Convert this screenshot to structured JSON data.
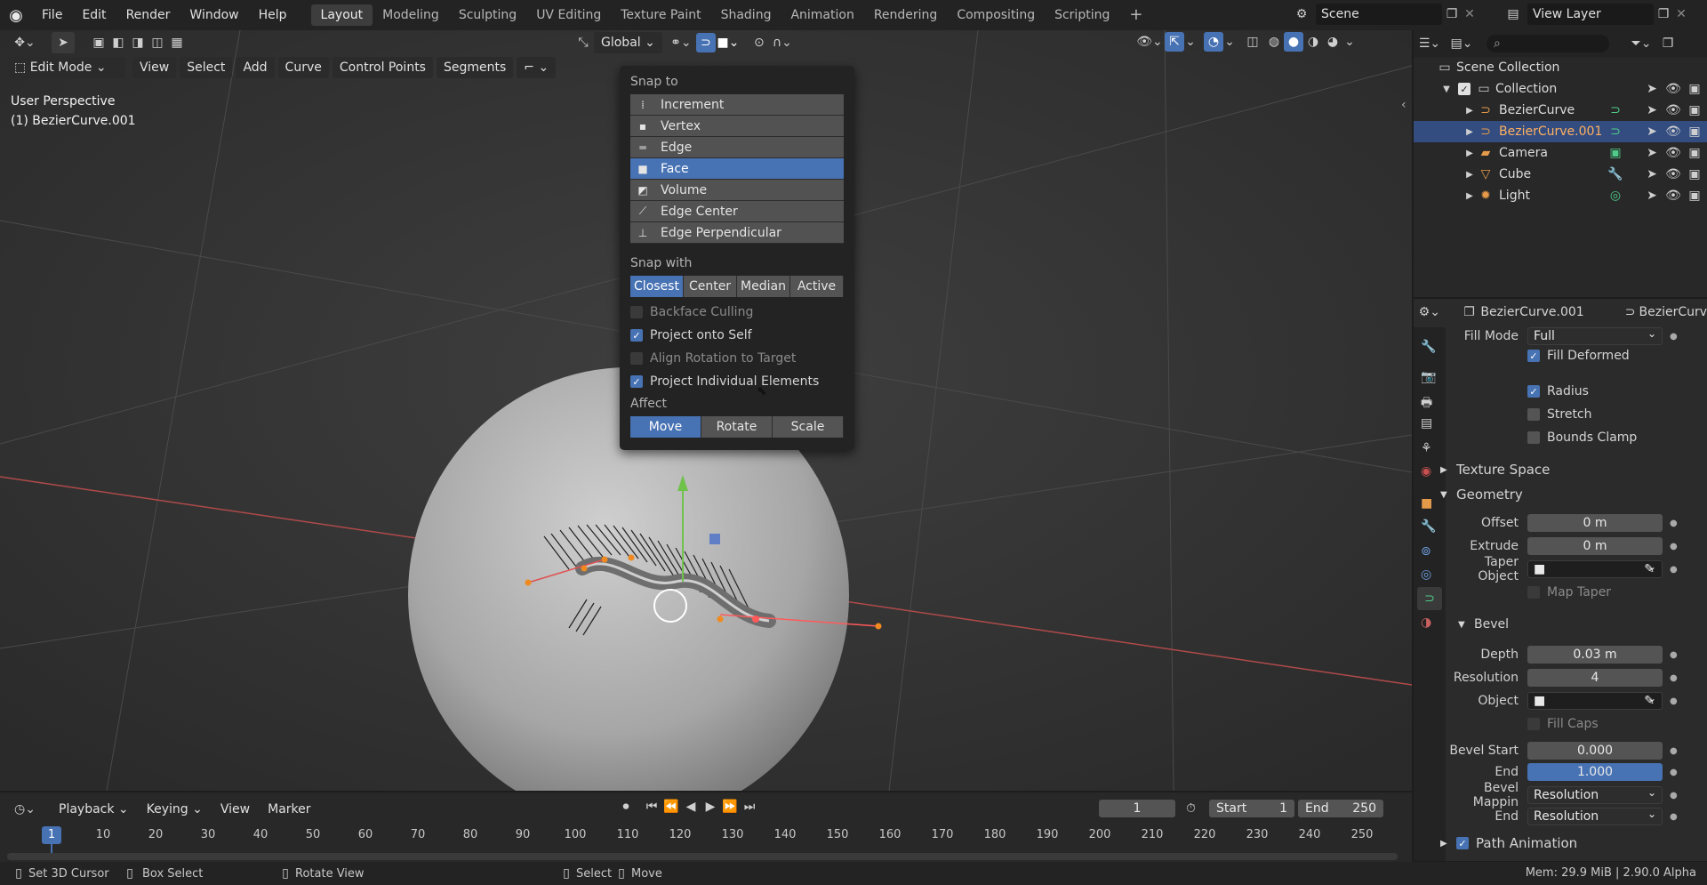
{
  "app": {
    "logo_icon": "blender-logo-icon"
  },
  "menu": [
    "File",
    "Edit",
    "Render",
    "Window",
    "Help"
  ],
  "workspaces": [
    "Layout",
    "Modeling",
    "Sculpting",
    "UV Editing",
    "Texture Paint",
    "Shading",
    "Animation",
    "Rendering",
    "Compositing",
    "Scripting"
  ],
  "active_workspace": "Layout",
  "add_workspace": "+",
  "scene": {
    "label": "Scene",
    "view_layer": "View Layer"
  },
  "viewport": {
    "orientation": "Global",
    "mode": "Edit Mode",
    "header_menus": [
      "View",
      "Select",
      "Add",
      "Curve",
      "Control Points",
      "Segments"
    ],
    "perspective_label": "User Perspective",
    "object_label": "(1) BezierCurve.001"
  },
  "snap_popover": {
    "snap_to_title": "Snap to",
    "snap_to_items": [
      {
        "label": "Increment",
        "icon": "increment-icon",
        "selected": false
      },
      {
        "label": "Vertex",
        "icon": "vertex-icon",
        "selected": false
      },
      {
        "label": "Edge",
        "icon": "edge-icon",
        "selected": false
      },
      {
        "label": "Face",
        "icon": "face-icon",
        "selected": true
      },
      {
        "label": "Volume",
        "icon": "volume-icon",
        "selected": false
      },
      {
        "label": "Edge Center",
        "icon": "edge-center-icon",
        "selected": false
      },
      {
        "label": "Edge Perpendicular",
        "icon": "edge-perpendicular-icon",
        "selected": false
      }
    ],
    "snap_with_title": "Snap with",
    "snap_with": [
      {
        "label": "Closest",
        "on": true
      },
      {
        "label": "Center",
        "on": false
      },
      {
        "label": "Median",
        "on": false
      },
      {
        "label": "Active",
        "on": false
      }
    ],
    "options": [
      {
        "label": "Backface Culling",
        "checked": false,
        "enabled": false
      },
      {
        "label": "Project onto Self",
        "checked": true,
        "enabled": true
      },
      {
        "label": "Align Rotation to Target",
        "checked": false,
        "enabled": false
      },
      {
        "label": "Project Individual Elements",
        "checked": true,
        "enabled": true
      }
    ],
    "affect_title": "Affect",
    "affect": [
      {
        "label": "Move",
        "on": true
      },
      {
        "label": "Rotate",
        "on": false
      },
      {
        "label": "Scale",
        "on": false
      }
    ]
  },
  "outliner": {
    "root": "Scene Collection",
    "collection": "Collection",
    "items": [
      {
        "label": "BezierCurve",
        "icon": "curve-icon",
        "color": "#e59a4a",
        "selected": false
      },
      {
        "label": "BezierCurve.001",
        "icon": "curve-icon",
        "color": "#e59a4a",
        "selected": true
      },
      {
        "label": "Camera",
        "icon": "camera-icon",
        "color": "#e59a4a",
        "selected": false
      },
      {
        "label": "Cube",
        "icon": "mesh-icon",
        "color": "#e59a4a",
        "selected": false
      },
      {
        "label": "Light",
        "icon": "light-icon",
        "color": "#e59a4a",
        "selected": false
      }
    ]
  },
  "properties": {
    "object_name": "BezierCurve.001",
    "data_name": "BezierCurv",
    "fill_mode_label": "Fill Mode",
    "fill_mode": "Full",
    "fill_deformed": "Fill Deformed",
    "radius": "Radius",
    "stretch": "Stretch",
    "bounds_clamp": "Bounds Clamp",
    "texture_space": "Texture Space",
    "geometry": "Geometry",
    "offset_label": "Offset",
    "offset": "0 m",
    "extrude_label": "Extrude",
    "extrude": "0 m",
    "taper_label": "Taper Object",
    "map_taper": "Map Taper",
    "bevel": "Bevel",
    "depth_label": "Depth",
    "depth": "0.03 m",
    "resolution_label": "Resolution",
    "resolution": "4",
    "object_label": "Object",
    "fill_caps": "Fill Caps",
    "bevel_start_label": "Bevel Start",
    "bevel_start": "0.000",
    "end_label": "End",
    "end": "1.000",
    "bevel_mapping_label": "Bevel Mappin",
    "bevel_mapping": "Resolution",
    "end_mapping_label": "End",
    "end_mapping": "Resolution",
    "path_animation": "Path Animation"
  },
  "timeline": {
    "menus": [
      "Playback",
      "Keying",
      "View",
      "Marker"
    ],
    "current_frame": "1",
    "start_label": "Start",
    "start": "1",
    "end_label": "End",
    "end": "250",
    "ticks": [
      "10",
      "20",
      "30",
      "40",
      "50",
      "60",
      "70",
      "80",
      "90",
      "100",
      "110",
      "120",
      "130",
      "140",
      "150",
      "160",
      "170",
      "180",
      "190",
      "200",
      "210",
      "220",
      "230",
      "240",
      "250"
    ],
    "playhead": "1"
  },
  "status": {
    "hints": [
      "Set 3D Cursor",
      "Box Select",
      "Rotate View",
      "Select",
      "Move"
    ],
    "memory": "Mem: 29.9 MiB | 2.90.0 Alpha"
  }
}
